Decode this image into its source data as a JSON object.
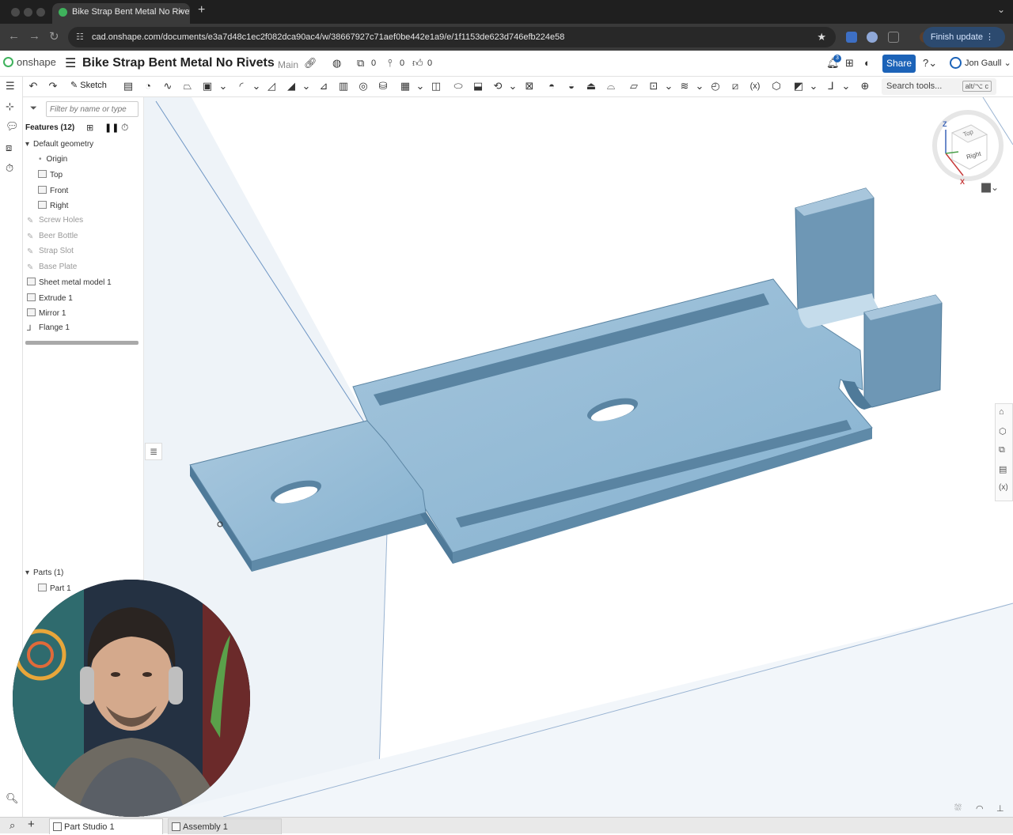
{
  "browser": {
    "tab_title": "Bike Strap Bent Metal No Rivets",
    "url": "cad.onshape.com/documents/e3a7d48c1ec2f082dca90ac4/w/38667927c71aef0be442e1a9/e/1f1153de623d746efb224e58",
    "finish_update_label": "Finish update"
  },
  "header": {
    "app_name": "onshape",
    "doc_title": "Bike Strap Bent Metal No Rivets",
    "branch": "Main",
    "versions_count": "0",
    "branches_count": "0",
    "likes_count": "0",
    "notifications_count": "3",
    "share_label": "Share",
    "user_name": "Jon Gaull"
  },
  "toolbar": {
    "sketch_label": "Sketch",
    "search_placeholder": "Search tools...",
    "search_shortcut": "alt/⌥ c"
  },
  "feature_panel": {
    "filter_placeholder": "Filter by name or type",
    "features_header": "Features (12)",
    "default_geometry": "Default geometry",
    "items": [
      {
        "label": "Origin",
        "type": "origin"
      },
      {
        "label": "Top",
        "type": "plane"
      },
      {
        "label": "Front",
        "type": "plane"
      },
      {
        "label": "Right",
        "type": "plane"
      },
      {
        "label": "Screw Holes",
        "type": "sketch"
      },
      {
        "label": "Beer Bottle",
        "type": "sketch"
      },
      {
        "label": "Strap Slot",
        "type": "sketch"
      },
      {
        "label": "Base Plate",
        "type": "sketch"
      },
      {
        "label": "Sheet metal model 1",
        "type": "feature"
      },
      {
        "label": "Extrude 1",
        "type": "feature"
      },
      {
        "label": "Mirror 1",
        "type": "feature"
      },
      {
        "label": "Flange 1",
        "type": "feature"
      }
    ],
    "parts_header": "Parts (1)",
    "parts": [
      "Part 1"
    ]
  },
  "view_cube": {
    "top": "Top",
    "right": "Right",
    "axis_z": "Z",
    "axis_x": "X"
  },
  "bottom_tabs": [
    "Part Studio 1",
    "Assembly 1"
  ],
  "colors": {
    "accent": "#1c63b8",
    "part": "#8fb6d3",
    "brand": "#3fb25c"
  }
}
